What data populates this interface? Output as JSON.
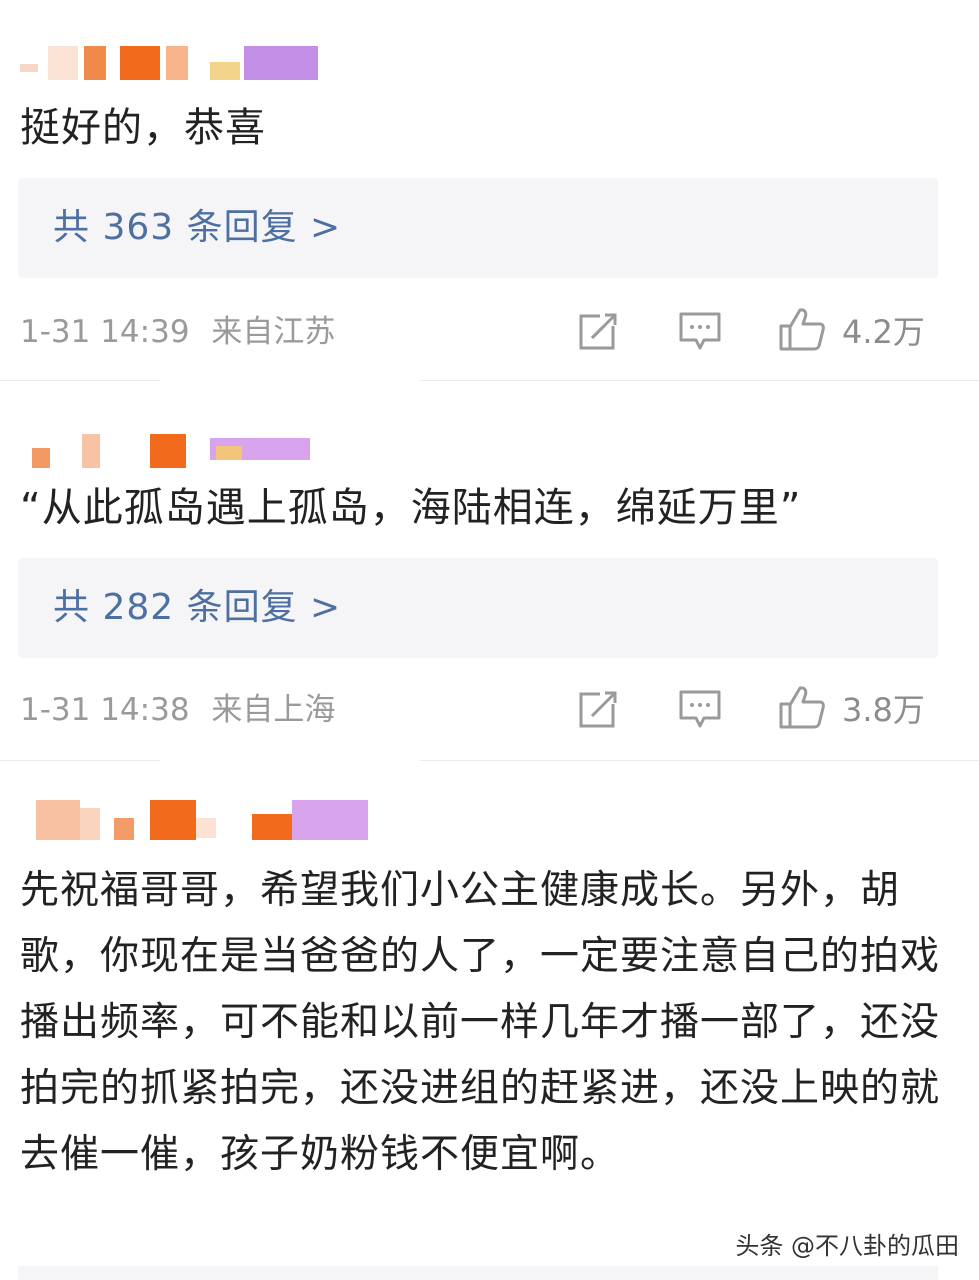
{
  "comments": [
    {
      "text": "挺好的，恭喜",
      "reply_label": "共 363 条回复 >",
      "time": "1-31 14:39",
      "location": "来自江苏",
      "likes": "4.2万"
    },
    {
      "text": "“从此孤岛遇上孤岛，海陆相连，绵延万里”",
      "reply_label": "共 282 条回复 >",
      "time": "1-31 14:38",
      "location": "来自上海",
      "likes": "3.8万"
    },
    {
      "text": "先祝福哥哥，希望我们小公主健康成长。另外，胡歌，你现在是当爸爸的人了，一定要注意自己的拍戏播出频率，可不能和以前一样几年才播一部了，还没拍完的抓紧拍完，还没进组的赶紧进，还没上映的就去催一催，孩子奶粉钱不便宜啊。"
    }
  ],
  "watermark": "头条 @不八卦的瓜田",
  "colors": {
    "reply_link": "#4d6fa2",
    "reply_bg": "#f5f5f7",
    "meta": "#9a9a9a"
  }
}
